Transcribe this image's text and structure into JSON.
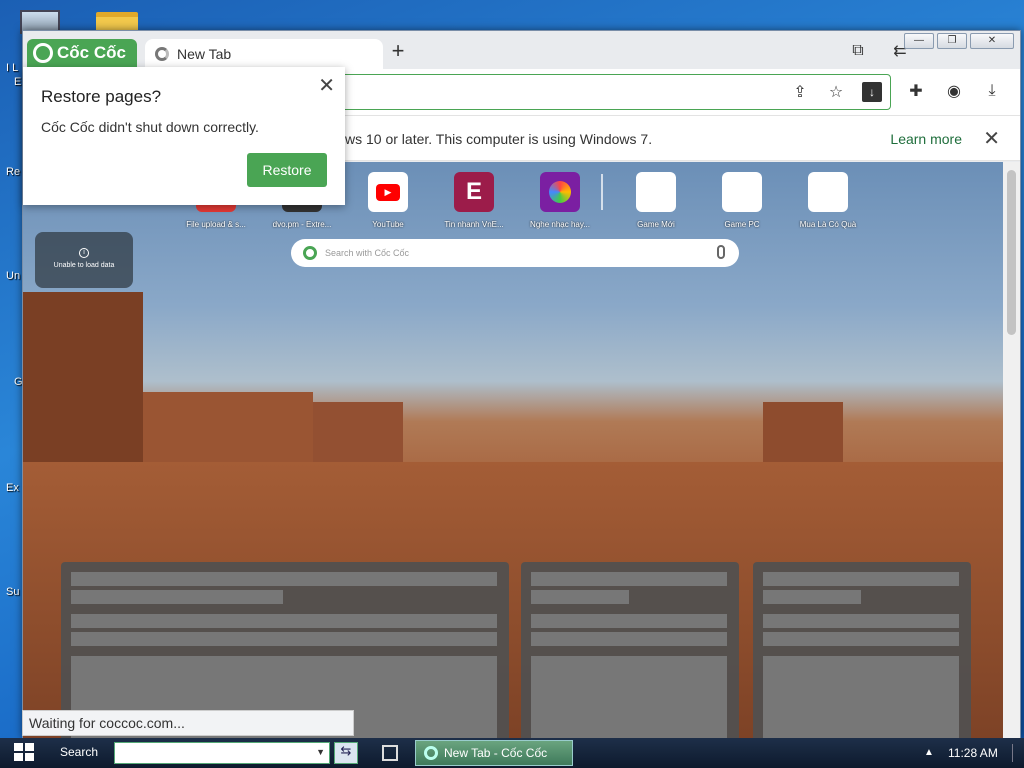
{
  "desktop": {
    "labels": [
      "I L",
      "E",
      "Re",
      "Un",
      "G",
      "Ex",
      "Su"
    ]
  },
  "browser": {
    "logo_text": "Cốc Cốc",
    "tab_title": "New Tab",
    "new_tab_symbol": "+",
    "infobar": {
      "message": "ws 10 or later. This computer is using Windows 7.",
      "learn_more": "Learn more",
      "close_symbol": "✕"
    },
    "popup": {
      "title": "Restore pages?",
      "message": "Cốc Cốc didn't shut down correctly.",
      "button": "Restore",
      "close_symbol": "✕"
    },
    "status_text": "Waiting for coccoc.com..."
  },
  "newtab": {
    "speed_dials": [
      {
        "label": "File upload & s...",
        "icon": "red-dial",
        "color": "#e53935"
      },
      {
        "label": "dvo.pm - Extre...",
        "icon": "dark-dial",
        "color": "#333333"
      },
      {
        "label": "YouTube",
        "icon": "youtube-icon",
        "color": "#ff0000"
      },
      {
        "label": "Tin nhanh VnE...",
        "icon": "E",
        "color": "#9c1c4a"
      },
      {
        "label": "Nghe nhạc hay...",
        "icon": "music-icon",
        "color": "#7b1fa2"
      },
      {
        "label": "Game Mới",
        "icon": "blank",
        "color": "#ffffff"
      },
      {
        "label": "Game PC",
        "icon": "blank",
        "color": "#ffffff"
      },
      {
        "label": "Mua Là Có Quà",
        "icon": "blank",
        "color": "#ffffff"
      }
    ],
    "search_placeholder": "Search with Cốc Cốc",
    "weather_text": "Unable to load data"
  },
  "taskbar": {
    "search_label": "Search",
    "app_label": "New Tab - Cốc Cốc",
    "clock": "11:28 AM"
  }
}
